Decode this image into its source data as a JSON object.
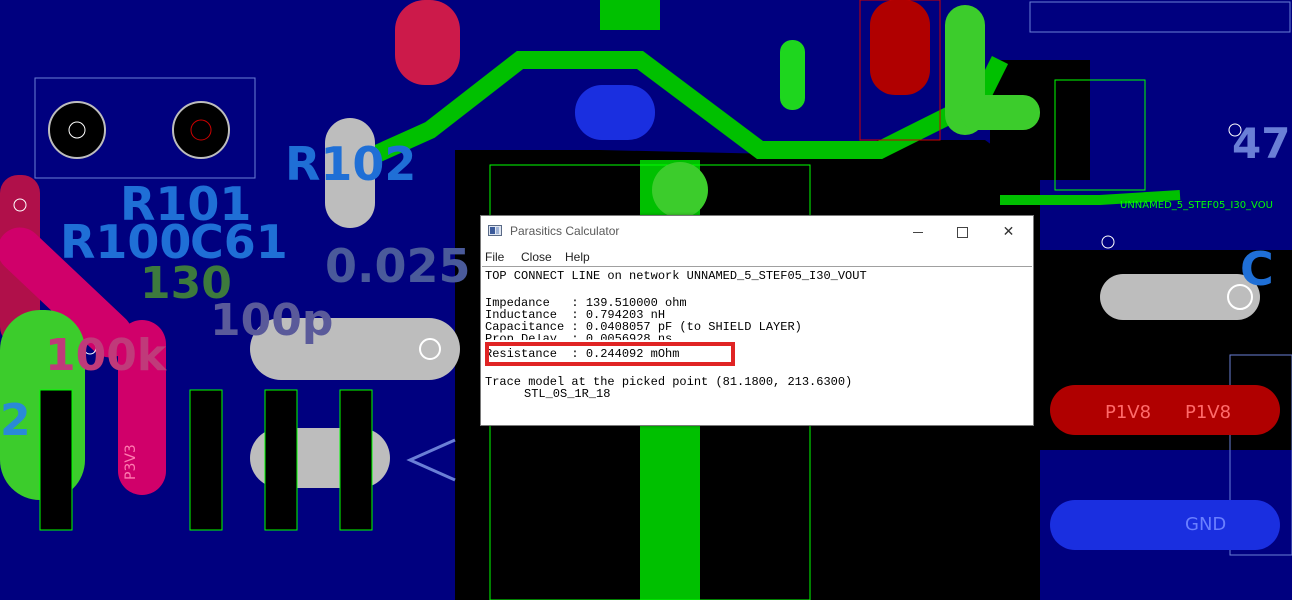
{
  "pcb": {
    "silkscreen": {
      "r102": "R102",
      "r101": "R101",
      "r100": "R100",
      "c61": "C61",
      "val_130": "130",
      "val_100p": "100p",
      "val_0025": "0.025",
      "val_100k": "100k",
      "val_2": "2",
      "val_47": "47",
      "val_c": "C",
      "net_label": "UNNAMED_5_STEF05_I30_VOU",
      "p1v8_a": "P1V8",
      "p1v8_b": "P1V8",
      "p3v3": "P3V3",
      "gnd": "GND"
    },
    "colors": {
      "board": "#00007f",
      "shield": "#000000",
      "trace": "#00c000",
      "copper_white": "#bdbdbd",
      "copper_red": "#d0006a",
      "copper_green": "#3ccc2c",
      "copper_blue": "#1a2fe0",
      "outline": "#00ff00",
      "red_pad": "#cc0000",
      "silk": "#1f6fd6"
    }
  },
  "window": {
    "title": "Parasitics Calculator",
    "controls": {
      "minimize": "—",
      "maximize": "☐",
      "close": "✕"
    },
    "menu": [
      "File",
      "Close",
      "Help"
    ],
    "header_line": "TOP CONNECT LINE on network UNNAMED_5_STEF05_I30_VOUT",
    "properties": [
      "Impedance   : 139.510000 ohm",
      "Inductance  : 0.794203 nH",
      "Capacitance : 0.0408057 pF (to SHIELD LAYER)",
      "Prop Delay  : 0.0056928 ns",
      "Resistance  : 0.244092 mOhm"
    ],
    "trace_model_line": "Trace model at the picked point (81.1800, 213.6300)",
    "trace_model_name": "STL_0S_1R_18",
    "highlight_color": "#e02424"
  }
}
